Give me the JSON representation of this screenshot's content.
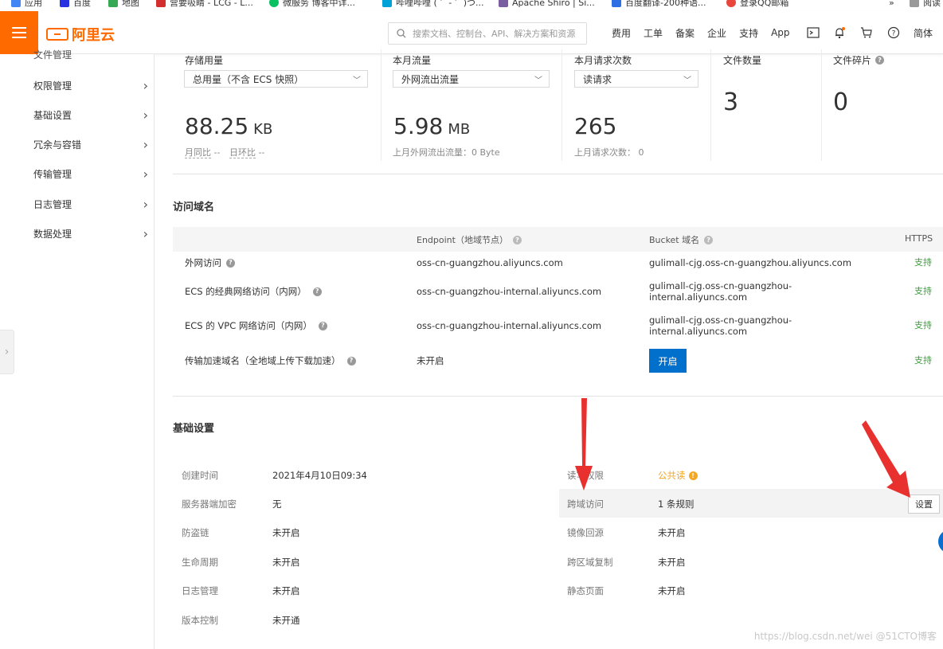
{
  "bookmarks": [
    {
      "label": "应用",
      "color": "#4285f4"
    },
    {
      "label": "百度",
      "color": "#2932e1"
    },
    {
      "label": "地图",
      "color": "#34a853"
    },
    {
      "label": "营要吸睛 - LCG - L...",
      "color": "#d32f2f"
    },
    {
      "label": "微服务 博客中详...",
      "color": "#07c160"
    },
    {
      "label": "哔哩哔哩 ( ゜- ゜)つ...",
      "color": "#00a1d6"
    },
    {
      "label": "Apache Shiro | Si...",
      "color": "#7a5fa0"
    },
    {
      "label": "百度翻译-200种语...",
      "color": "#2f6fe4"
    },
    {
      "label": "登录QQ邮箱",
      "color": "#e8453c"
    },
    {
      "label": "»",
      "color": ""
    },
    {
      "label": "阅读",
      "color": "#999999"
    }
  ],
  "topbar": {
    "logo_text": "阿里云",
    "search_placeholder": "搜索文档、控制台、API、解决方案和资源",
    "links": [
      "费用",
      "工单",
      "备案",
      "企业",
      "支持",
      "App"
    ],
    "lang": "简体",
    "accent": "#ff6a00"
  },
  "sidebar": {
    "partial_top": "文件管理",
    "items": [
      "权限管理",
      "基础设置",
      "冗余与容错",
      "传输管理",
      "日志管理",
      "数据处理"
    ]
  },
  "stats": {
    "storage": {
      "label": "存储用量",
      "select": "总用量（不含 ECS 快照）",
      "value": "88.25",
      "unit": "KB",
      "sub1": "月同比",
      "sub1_val": "--",
      "sub2": "日环比",
      "sub2_val": "--"
    },
    "traffic": {
      "label": "本月流量",
      "select": "外网流出流量",
      "value": "5.98",
      "unit": "MB",
      "sub": "上月外网流出流量：0 Byte"
    },
    "requests": {
      "label": "本月请求次数",
      "select": "读请求",
      "value": "265",
      "sub": "上月请求次数： 0"
    },
    "files": {
      "label": "文件数量",
      "value": "3"
    },
    "fragments": {
      "label": "文件碎片",
      "value": "0"
    }
  },
  "domains": {
    "title": "访问域名",
    "headers": {
      "endpoint": "Endpoint（地域节点）",
      "bucket": "Bucket 域名",
      "https": "HTTPS"
    },
    "rows": [
      {
        "name": "外网访问",
        "endpoint": "oss-cn-guangzhou.aliyuncs.com",
        "bucket1": "gulimall-cjg.oss-cn-guangzhou.aliyuncs.com",
        "bucket2": "",
        "https": "支持"
      },
      {
        "name": "ECS 的经典网络访问（内网）",
        "endpoint": "oss-cn-guangzhou-internal.aliyuncs.com",
        "bucket1": "gulimall-cjg.oss-cn-guangzhou-",
        "bucket2": "internal.aliyuncs.com",
        "https": "支持"
      },
      {
        "name": "ECS 的 VPC 网络访问（内网）",
        "endpoint": "oss-cn-guangzhou-internal.aliyuncs.com",
        "bucket1": "gulimall-cjg.oss-cn-guangzhou-",
        "bucket2": "internal.aliyuncs.com",
        "https": "支持"
      },
      {
        "name": "传输加速域名（全地域上传下载加速）",
        "endpoint": "未开启",
        "button": "开启",
        "https": "支持"
      }
    ]
  },
  "basic": {
    "title": "基础设置",
    "left": [
      {
        "label": "创建时间",
        "value": "2021年4月10日09:34"
      },
      {
        "label": "服务器端加密",
        "value": "无"
      },
      {
        "label": "防盗链",
        "value": "未开启"
      },
      {
        "label": "生命周期",
        "value": "未开启"
      },
      {
        "label": "日志管理",
        "value": "未开启"
      },
      {
        "label": "版本控制",
        "value": "未开通"
      }
    ],
    "right": [
      {
        "label": "读写权限",
        "value": "公共读"
      },
      {
        "label": "跨域访问",
        "value": "1 条规则",
        "button": "设置"
      },
      {
        "label": "镜像回源",
        "value": "未开启"
      },
      {
        "label": "跨区域复制",
        "value": "未开启"
      },
      {
        "label": "静态页面",
        "value": "未开启"
      }
    ]
  },
  "watermark": "https://blog.csdn.net/wei @51CTO博客",
  "annotation_color": "#e8312f"
}
